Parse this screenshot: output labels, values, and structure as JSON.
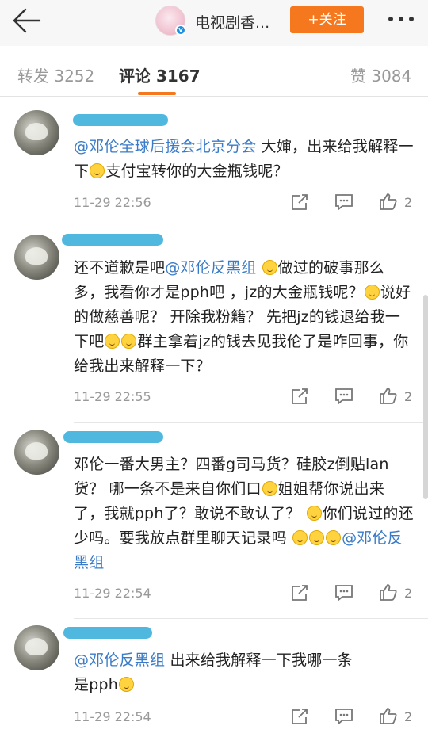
{
  "header": {
    "title": "电视剧香...",
    "follow_label": "+关注",
    "accent_color": "#f5781e"
  },
  "tabs": [
    {
      "label": "转发 3252"
    },
    {
      "label": "评论 3167"
    },
    {
      "label": "赞 3084"
    }
  ],
  "comments": [
    {
      "mention1": "@邓伦全球后援会北京分会",
      "t1": " 大婶，出来给我解释一下",
      "t2": "支付宝转你的大金瓶钱呢？",
      "time": "11-29 22:56",
      "likes": "2"
    },
    {
      "t1": "还不道歉是吧",
      "mention1": "@邓伦反黑组",
      "t2": "做过的破事那么多，我看你才是pph吧 ，jz的大金瓶钱呢？",
      "t3": "说好的做慈善呢？ 开除我粉籍？ 先把jz的钱退给我一下吧",
      "t4": "群主拿着jz的钱去见我伦了是咋回事，你给我出来解释一下？",
      "time": "11-29 22:55",
      "likes": "2"
    },
    {
      "t1": "邓伦一番大男主？四番g司马货？硅胶z倒贴lan货？ 哪一条不是来自你们口",
      "t2": "姐姐帮你说出来了，我就pph了？敢说不敢认了？ ",
      "t3": "你们说过的还少吗。要我放点群里聊天记录吗",
      "mention1": "@邓伦反黑组",
      "time": "11-29 22:54",
      "likes": "2"
    },
    {
      "mention1": "@邓伦反黑组",
      "t1": " 出来给我解释一下我哪一条是pph",
      "time": "11-29 22:54",
      "likes": "2"
    }
  ]
}
